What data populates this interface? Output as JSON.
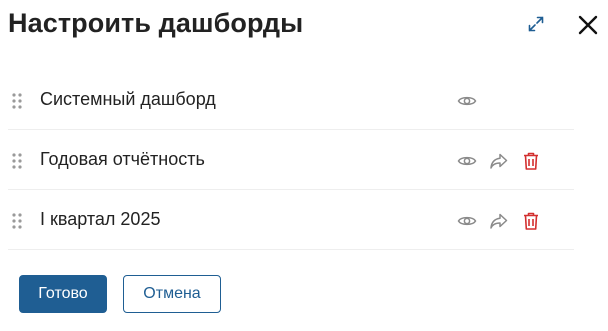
{
  "dialog": {
    "title": "Настроить дашборды",
    "expand_icon": "expand-arrows-icon",
    "close_icon": "close-icon"
  },
  "dashboards": [
    {
      "label": "Системный дашборд",
      "actions": [
        "eye-icon"
      ]
    },
    {
      "label": "Годовая отчётность",
      "actions": [
        "eye-icon",
        "share-arrow-icon",
        "trash-icon"
      ]
    },
    {
      "label": "I квартал 2025",
      "actions": [
        "eye-icon",
        "share-arrow-icon",
        "trash-icon"
      ]
    }
  ],
  "footer": {
    "done_label": "Готово",
    "cancel_label": "Отмена"
  },
  "colors": {
    "primary": "#1f5e93",
    "danger": "#d32f2f",
    "icon_gray": "#8a8a8a",
    "text": "#222222"
  }
}
